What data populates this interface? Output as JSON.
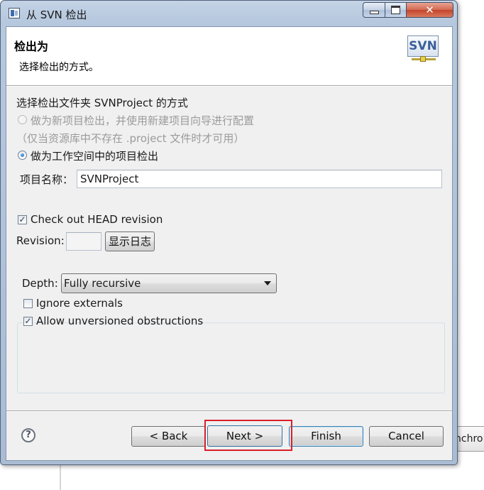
{
  "window": {
    "title": "从 SVN 检出",
    "close_glyph": "✕"
  },
  "banner": {
    "title": "检出为",
    "description": "选择检出的方式。",
    "logo_text": "SVN"
  },
  "options": {
    "heading": "选择检出文件夹 SVNProject 的方式",
    "radio_new_project": "做为新项目检出，并使用新建项目向导进行配置",
    "radio_new_project_note": "（仅当资源库中不存在 .project 文件时才可用）",
    "radio_workspace_project": "做为工作空间中的项目检出",
    "project_name_label": "项目名称：",
    "project_name_value": "SVNProject"
  },
  "revision": {
    "head_checkbox_label": "Check out HEAD revision",
    "head_checked": true,
    "revision_label": "Revision:",
    "revision_value": "",
    "show_log_button": "显示日志"
  },
  "depth": {
    "label": "Depth:",
    "selected": "Fully recursive",
    "ignore_externals_label": "Ignore externals",
    "ignore_externals_checked": false,
    "allow_unversioned_label": "Allow unversioned obstructions",
    "allow_unversioned_checked": true
  },
  "footer": {
    "help_glyph": "?",
    "back": "< Back",
    "next": "Next >",
    "finish": "Finish",
    "cancel": "Cancel"
  },
  "background": {
    "partial_text": "nchro"
  },
  "colors": {
    "highlight": "#d8202a",
    "dialog_bg": "#f0f0f0",
    "frame": "#b6c8de"
  }
}
